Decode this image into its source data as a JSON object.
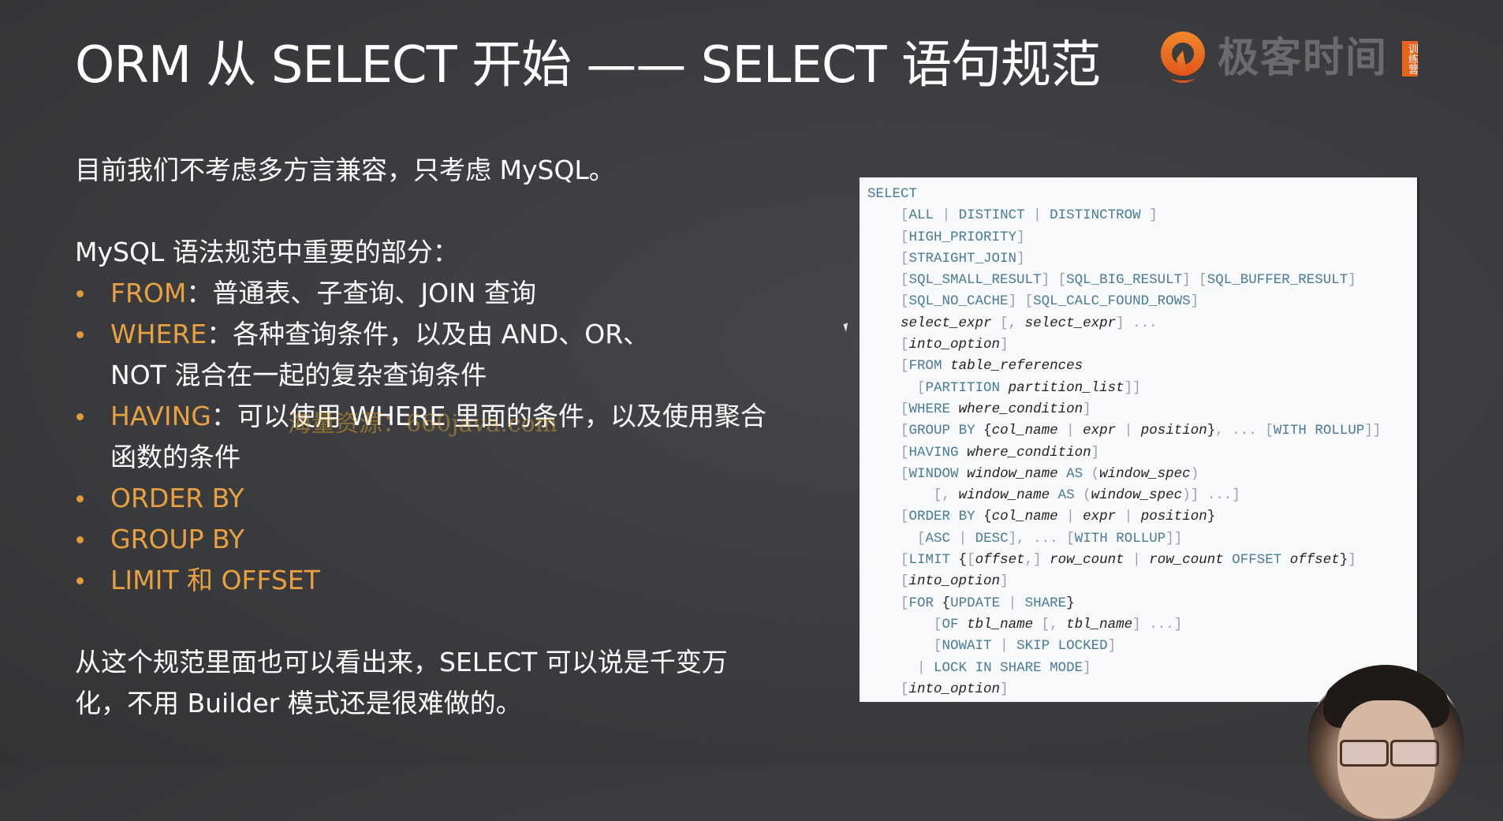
{
  "slide": {
    "title": "ORM 从 SELECT 开始 —— SELECT 语句规范",
    "logo": {
      "icon": "geektime-logo-icon",
      "text": "极客时间",
      "badge": "训练营",
      "accent_color": "#e8641d"
    },
    "intro": "目前我们不考虑多方言兼容，只考虑 MySQL。",
    "section_heading": "MySQL 语法规范中重要的部分：",
    "bullets": [
      {
        "keyword": "FROM",
        "text": "：普通表、子查询、JOIN 查询"
      },
      {
        "keyword": "WHERE",
        "text": "：各种查询条件，以及由 AND、OR、NOT 混合在一起的复杂查询条件"
      },
      {
        "keyword": "HAVING",
        "text": "：可以使用 WHERE 里面的条件，以及使用聚合函数的条件"
      },
      {
        "keyword": "ORDER BY",
        "text": ""
      },
      {
        "keyword": "GROUP BY",
        "text": ""
      },
      {
        "keyword": "LIMIT 和 OFFSET",
        "text": ""
      }
    ],
    "conclusion": "从这个规范里面也可以看出来，SELECT 可以说是千变万化，不用 Builder 模式还是很难做的。",
    "watermark": "海量资源：660java.com",
    "keyword_color": "#e8a040"
  },
  "code": {
    "language": "sql",
    "lines": [
      "SELECT",
      "    [ALL | DISTINCT | DISTINCTROW ]",
      "    [HIGH_PRIORITY]",
      "    [STRAIGHT_JOIN]",
      "    [SQL_SMALL_RESULT] [SQL_BIG_RESULT] [SQL_BUFFER_RESULT]",
      "    [SQL_NO_CACHE] [SQL_CALC_FOUND_ROWS]",
      "    select_expr [, select_expr] ...",
      "    [into_option]",
      "    [FROM table_references",
      "      [PARTITION partition_list]]",
      "    [WHERE where_condition]",
      "    [GROUP BY {col_name | expr | position}, ... [WITH ROLLUP]]",
      "    [HAVING where_condition]",
      "    [WINDOW window_name AS (window_spec)",
      "        [, window_name AS (window_spec)] ...]",
      "    [ORDER BY {col_name | expr | position}",
      "      [ASC | DESC], ... [WITH ROLLUP]]",
      "    [LIMIT {[offset,] row_count | row_count OFFSET offset}]",
      "    [into_option]",
      "    [FOR {UPDATE | SHARE}",
      "        [OF tbl_name [, tbl_name] ...]",
      "        [NOWAIT | SKIP LOCKED]",
      "      | LOCK IN SHARE MODE]",
      "    [into_option]"
    ],
    "keywords": [
      "SELECT",
      "ALL",
      "DISTINCT",
      "DISTINCTROW",
      "HIGH_PRIORITY",
      "STRAIGHT_JOIN",
      "SQL_SMALL_RESULT",
      "SQL_BIG_RESULT",
      "SQL_BUFFER_RESULT",
      "SQL_NO_CACHE",
      "SQL_CALC_FOUND_ROWS",
      "FROM",
      "PARTITION",
      "WHERE",
      "GROUP",
      "BY",
      "WITH",
      "ROLLUP",
      "HAVING",
      "WINDOW",
      "AS",
      "ORDER",
      "ASC",
      "DESC",
      "LIMIT",
      "OFFSET",
      "FOR",
      "UPDATE",
      "SHARE",
      "OF",
      "NOWAIT",
      "SKIP",
      "LOCKED",
      "LOCK",
      "IN",
      "MODE"
    ],
    "keyword_color": "#4a7a96",
    "punct_color": "#9aa0a6"
  },
  "webcam": {
    "label": "presenter-webcam"
  }
}
